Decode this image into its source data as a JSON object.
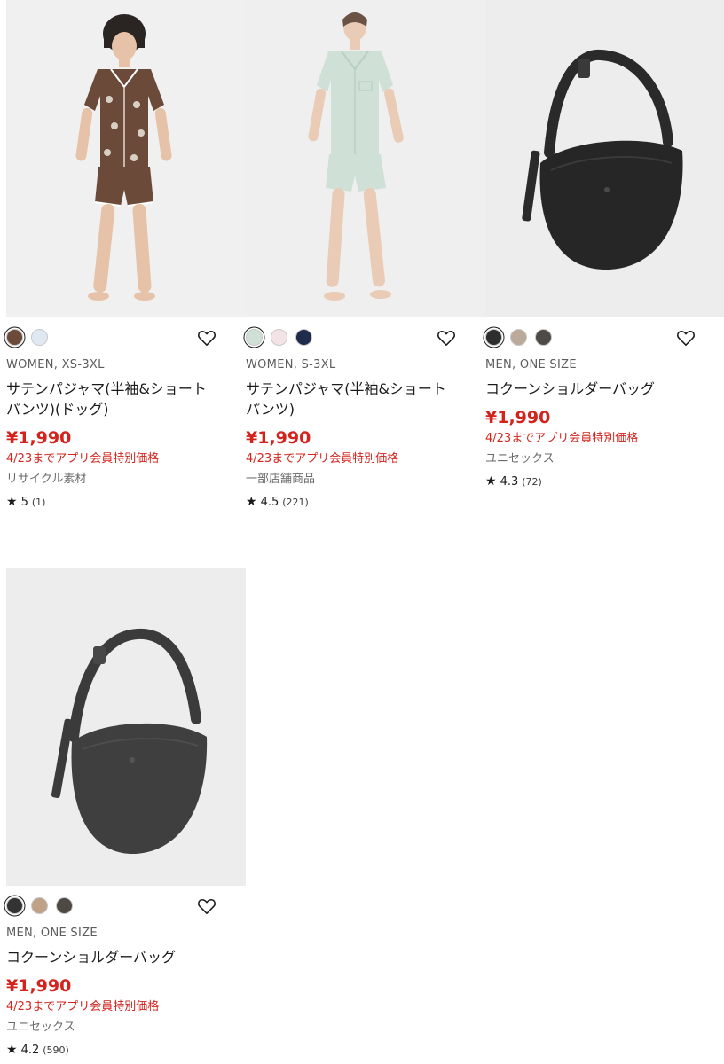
{
  "products": [
    {
      "image": "satin-pajama-dog-brown-photo",
      "swatches": [
        "#6b4a3a",
        "#dfe8f3"
      ],
      "selected_swatch": 0,
      "gender_size": "WOMEN, XS-3XL",
      "name": "サテンパジャマ(半袖&ショートパンツ)(ドッグ)",
      "price": "¥1,990",
      "promo": "4/23までアプリ会員特別価格",
      "note": "リサイクル素材",
      "rating": "5",
      "review_count": "(1)"
    },
    {
      "image": "satin-pajama-mint-photo",
      "swatches": [
        "#cfe1d6",
        "#f3e3e6",
        "#1f2b4a"
      ],
      "selected_swatch": 0,
      "gender_size": "WOMEN, S-3XL",
      "name": "サテンパジャマ(半袖&ショートパンツ)",
      "price": "¥1,990",
      "promo": "4/23までアプリ会員特別価格",
      "note": "一部店舗商品",
      "rating": "4.5",
      "review_count": "(221)"
    },
    {
      "image": "cocoon-shoulder-bag-black-photo",
      "swatches": [
        "#2e2e2e",
        "#bba999",
        "#4e4a48"
      ],
      "selected_swatch": 0,
      "gender_size": "MEN, ONE SIZE",
      "name": "コクーンショルダーバッグ",
      "price": "¥1,990",
      "promo": "4/23までアプリ会員特別価格",
      "note": "ユニセックス",
      "rating": "4.3",
      "review_count": "(72)"
    },
    {
      "image": "cocoon-shoulder-bag-gray-photo",
      "swatches": [
        "#333333",
        "#bfa285",
        "#4f4944"
      ],
      "selected_swatch": 0,
      "gender_size": "MEN, ONE SIZE",
      "name": "コクーンショルダーバッグ",
      "price": "¥1,990",
      "promo": "4/23までアプリ会員特別価格",
      "note": "ユニセックス",
      "rating": "4.2",
      "review_count": "(590)"
    }
  ],
  "icons": {
    "favorite": "heart-outline-icon",
    "rating": "star-icon"
  },
  "colors": {
    "price_red": "#d3231c",
    "text": "#1b1b1b",
    "muted": "#6b6b6b"
  }
}
